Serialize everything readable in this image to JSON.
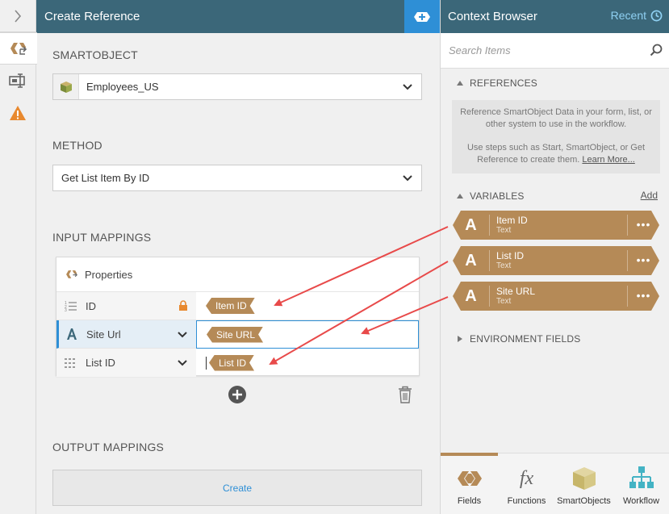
{
  "left_panel": {
    "title": "Create Reference",
    "smartobject_section": "SMARTOBJECT",
    "smartobject_value": "Employees_US",
    "method_section": "METHOD",
    "method_value": "Get List Item By ID",
    "input_section": "INPUT MAPPINGS",
    "properties_header": "Properties",
    "rows": [
      {
        "label": "ID",
        "value": "Item ID"
      },
      {
        "label": "Site Url",
        "value": "Site URL"
      },
      {
        "label": "List ID",
        "value": "List ID"
      }
    ],
    "output_section": "OUTPUT MAPPINGS",
    "create_label": "Create"
  },
  "context_browser": {
    "title": "Context Browser",
    "recent_label": "Recent",
    "search_placeholder": "Search Items",
    "references_label": "REFERENCES",
    "references_info_1": "Reference SmartObject Data in your form, list, or other system to use in the workflow.",
    "references_info_2": "Use steps such as Start, SmartObject, or Get Reference to create them.",
    "learn_more": "Learn More...",
    "variables_label": "VARIABLES",
    "add_label": "Add",
    "variables": [
      {
        "name": "Item ID",
        "type": "Text",
        "glyph": "A"
      },
      {
        "name": "List ID",
        "type": "Text",
        "glyph": "A"
      },
      {
        "name": "Site URL",
        "type": "Text",
        "glyph": "A"
      }
    ],
    "more_glyph": "•••",
    "environment_label": "ENVIRONMENT FIELDS",
    "tabs": [
      "Fields",
      "Functions",
      "SmartObjects",
      "Workflow"
    ],
    "functions_glyph": "fx"
  },
  "colors": {
    "header": "#3b6779",
    "accent_blue": "#2e8fd6",
    "tag_brown": "#b58a57",
    "warning": "#e8892f",
    "arrow": "#e84a4a"
  },
  "icons": [
    "chevron-right-icon",
    "reference-icon",
    "form-icon",
    "warning-icon",
    "add-reference-icon",
    "clock-icon",
    "search-icon",
    "smartobject-cube-icon",
    "chevron-down-icon",
    "lock-icon",
    "numbered-list-icon",
    "text-a-icon",
    "grid-icon",
    "plus-circle-icon",
    "trash-icon",
    "fields-icon",
    "functions-icon",
    "smartobjects-icon",
    "workflow-icon"
  ]
}
